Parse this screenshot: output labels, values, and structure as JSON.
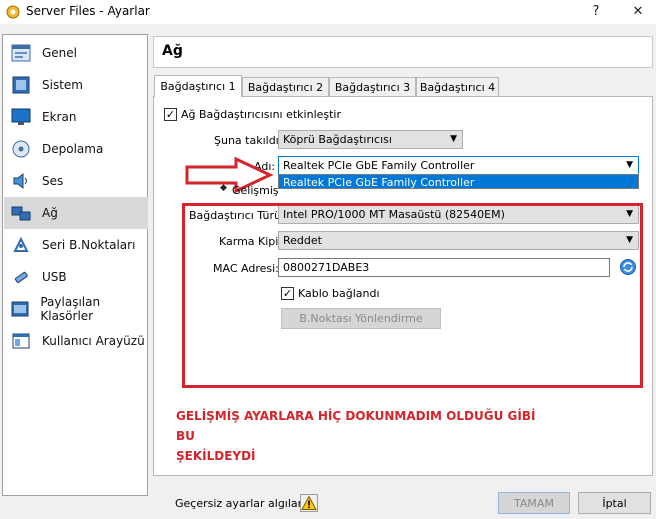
{
  "window": {
    "title": "Server Files - Ayarlar",
    "help_glyph": "?",
    "close_glyph": "✕"
  },
  "sidebar": {
    "items": [
      {
        "label": "Genel",
        "icon": "general-icon"
      },
      {
        "label": "Sistem",
        "icon": "system-icon"
      },
      {
        "label": "Ekran",
        "icon": "display-icon"
      },
      {
        "label": "Depolama",
        "icon": "storage-icon"
      },
      {
        "label": "Ses",
        "icon": "audio-icon"
      },
      {
        "label": "Ağ",
        "icon": "network-icon",
        "selected": true
      },
      {
        "label": "Seri B.Noktaları",
        "icon": "serial-port-icon"
      },
      {
        "label": "USB",
        "icon": "usb-icon"
      },
      {
        "label": "Paylaşılan Klasörler",
        "icon": "shared-folder-icon"
      },
      {
        "label": "Kullanıcı Arayüzü",
        "icon": "user-interface-icon"
      }
    ]
  },
  "header": {
    "title": "Ağ"
  },
  "tabs": [
    {
      "label": "Bağdaştırıcı 1",
      "active": true
    },
    {
      "label": "Bağdaştırıcı 2"
    },
    {
      "label": "Bağdaştırıcı 3"
    },
    {
      "label": "Bağdaştırıcı 4"
    }
  ],
  "adapter": {
    "enable_label": "Ağ Bağdaştırıcısını etkinleştir",
    "enable_checked": "✓",
    "attached_label": "Şuna takıldı:",
    "attached_value": "Köprü Bağdaştırıcısı",
    "name_label": "Adı:",
    "name_value": "Realtek PCIe GbE Family Controller",
    "name_dropdown_option": "Realtek PCIe GbE Family Controller",
    "advanced_label": "Gelişmiş",
    "adapter_type_label": "Bağdaştırıcı Türü:",
    "adapter_type_value": "Intel PRO/1000 MT Masaüstü (82540EM)",
    "promiscuous_label": "Karma Kipi:",
    "promiscuous_value": "Reddet",
    "mac_label": "MAC Adresi:",
    "mac_value": "0800271DABE3",
    "cable_label": "Kablo bağlandı",
    "cable_checked": "✓",
    "port_forwarding_label": "B.Noktası Yönlendirme"
  },
  "annotation": {
    "line1": "GELİŞMİŞ AYARLARA HİÇ DOKUNMADIM OLDUĞU GİBİ BU",
    "line2": "ŞEKİLDEYDİ"
  },
  "footer": {
    "invalid_text": "Geçersiz ayarlar algılandı",
    "ok_label": "TAMAM",
    "cancel_label": "İptal"
  },
  "colors": {
    "accent": "#0078d7",
    "annotation_red": "#d3252b",
    "selected_bg": "#d9d9d9"
  }
}
